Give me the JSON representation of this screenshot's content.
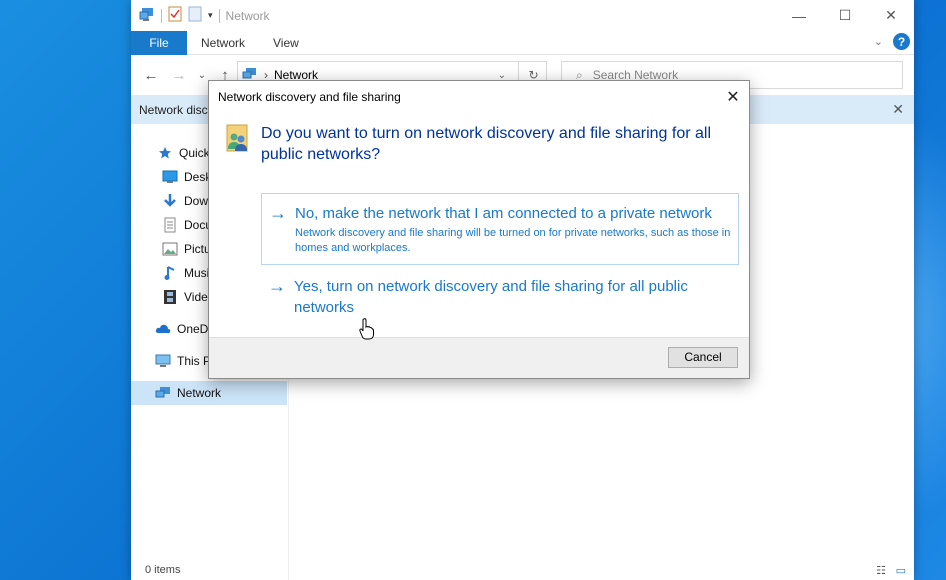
{
  "explorer": {
    "title": "Network",
    "ribbon_tabs": [
      "File",
      "Network",
      "View"
    ],
    "address": "Network",
    "search_placeholder": "Search Network",
    "infobar_text": "Network disc",
    "status": "0 items"
  },
  "nav": {
    "items": [
      {
        "label": "Quick",
        "icon": "star-icon"
      },
      {
        "label": "Desk",
        "icon": "desktop-icon"
      },
      {
        "label": "Dow",
        "icon": "download-icon"
      },
      {
        "label": "Docu",
        "icon": "document-icon"
      },
      {
        "label": "Pictu",
        "icon": "pictures-icon"
      },
      {
        "label": "Musi",
        "icon": "music-icon"
      },
      {
        "label": "Vide",
        "icon": "video-icon"
      },
      {
        "label": "OneDr",
        "icon": "cloud-icon"
      },
      {
        "label": "This P",
        "icon": "computer-icon"
      },
      {
        "label": "Network",
        "icon": "network-icon"
      }
    ]
  },
  "dialog": {
    "title": "Network discovery and file sharing",
    "question": "Do you want to turn on network discovery and file sharing for all public networks?",
    "option_private": {
      "main": "No, make the network that I am connected to a private network",
      "sub": "Network discovery and file sharing will be turned on for private networks, such as those in homes and workplaces."
    },
    "option_public": {
      "main": "Yes, turn on network discovery and file sharing for all public networks"
    },
    "cancel_label": "Cancel"
  },
  "colors": {
    "accent": "#1979ca",
    "question": "#003399",
    "infobar": "#d9ebf9",
    "selected": "#cce4f7"
  }
}
